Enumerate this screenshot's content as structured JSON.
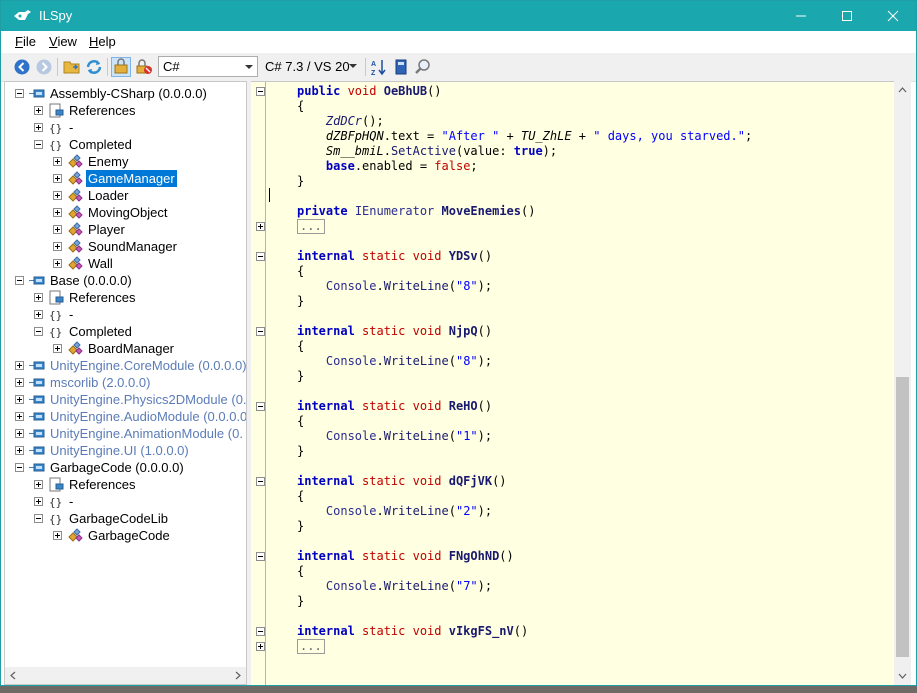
{
  "window": {
    "title": "ILSpy"
  },
  "menu": [
    {
      "accel": "F",
      "rest": "ile"
    },
    {
      "accel": "V",
      "rest": "iew"
    },
    {
      "accel": "H",
      "rest": "elp"
    }
  ],
  "toolbar": {
    "language": "C#",
    "version": "C# 7.3 / VS 20"
  },
  "tree": [
    {
      "label": "Assembly-CSharp (0.0.0.0)",
      "expander": "minus",
      "icon": "assembly-icon",
      "muted": false,
      "selected": false
    },
    {
      "label": "References",
      "expander": "plus",
      "icon": "references-icon",
      "muted": false,
      "selected": false
    },
    {
      "label": "-",
      "expander": "plus",
      "icon": "namespace-icon",
      "muted": false,
      "selected": false
    },
    {
      "label": "Completed",
      "expander": "minus",
      "icon": "namespace-icon",
      "muted": false,
      "selected": false
    },
    {
      "label": "Enemy",
      "expander": "plus",
      "icon": "class-icon",
      "muted": false,
      "selected": false
    },
    {
      "label": "GameManager",
      "expander": "plus",
      "icon": "class-icon",
      "muted": false,
      "selected": true
    },
    {
      "label": "Loader",
      "expander": "plus",
      "icon": "class-icon",
      "muted": false,
      "selected": false
    },
    {
      "label": "MovingObject",
      "expander": "plus",
      "icon": "class-icon",
      "muted": false,
      "selected": false
    },
    {
      "label": "Player",
      "expander": "plus",
      "icon": "class-icon",
      "muted": false,
      "selected": false
    },
    {
      "label": "SoundManager",
      "expander": "plus",
      "icon": "class-icon",
      "muted": false,
      "selected": false
    },
    {
      "label": "Wall",
      "expander": "plus",
      "icon": "class-icon",
      "muted": false,
      "selected": false
    },
    {
      "label": "Base (0.0.0.0)",
      "expander": "minus",
      "icon": "assembly-icon",
      "muted": false,
      "selected": false
    },
    {
      "label": "References",
      "expander": "plus",
      "icon": "references-icon",
      "muted": false,
      "selected": false
    },
    {
      "label": "-",
      "expander": "plus",
      "icon": "namespace-icon",
      "muted": false,
      "selected": false
    },
    {
      "label": "Completed",
      "expander": "minus",
      "icon": "namespace-icon",
      "muted": false,
      "selected": false
    },
    {
      "label": "BoardManager",
      "expander": "plus",
      "icon": "class-icon",
      "muted": false,
      "selected": false
    },
    {
      "label": "UnityEngine.CoreModule (0.0.0.0)",
      "expander": "plus",
      "icon": "assembly-icon",
      "muted": true,
      "selected": false
    },
    {
      "label": "mscorlib (2.0.0.0)",
      "expander": "plus",
      "icon": "assembly-icon",
      "muted": true,
      "selected": false
    },
    {
      "label": "UnityEngine.Physics2DModule (0.0",
      "expander": "plus",
      "icon": "assembly-icon",
      "muted": true,
      "selected": false
    },
    {
      "label": "UnityEngine.AudioModule (0.0.0.0",
      "expander": "plus",
      "icon": "assembly-icon",
      "muted": true,
      "selected": false
    },
    {
      "label": "UnityEngine.AnimationModule (0.",
      "expander": "plus",
      "icon": "assembly-icon",
      "muted": true,
      "selected": false
    },
    {
      "label": "UnityEngine.UI (1.0.0.0)",
      "expander": "plus",
      "icon": "assembly-icon",
      "muted": true,
      "selected": false
    },
    {
      "label": "GarbageCode (0.0.0.0)",
      "expander": "minus",
      "icon": "assembly-icon",
      "muted": false,
      "selected": false
    },
    {
      "label": "References",
      "expander": "plus",
      "icon": "references-icon",
      "muted": false,
      "selected": false
    },
    {
      "label": "-",
      "expander": "plus",
      "icon": "namespace-icon",
      "muted": false,
      "selected": false
    },
    {
      "label": "GarbageCodeLib",
      "expander": "minus",
      "icon": "namespace-icon",
      "muted": false,
      "selected": false
    },
    {
      "label": "GarbageCode",
      "expander": "plus",
      "icon": "class-icon",
      "muted": false,
      "selected": false
    }
  ],
  "code": [
    {
      "fold": "minus",
      "tokens": [
        [
          "kw",
          "public"
        ],
        [
          "",
          ""
        ],
        [
          "kw2",
          " void "
        ],
        [
          "fn",
          "OeBhUB"
        ],
        [
          "",
          "()"
        ]
      ]
    },
    {
      "fold": "",
      "tokens": [
        [
          "",
          "{"
        ]
      ]
    },
    {
      "fold": "",
      "tokens": [
        [
          "",
          "    "
        ],
        [
          "it meth",
          "ZdDCr"
        ],
        [
          "",
          "();"
        ]
      ]
    },
    {
      "fold": "",
      "tokens": [
        [
          "",
          "    "
        ],
        [
          "it",
          "dZBFpHQN"
        ],
        [
          "",
          ".text = "
        ],
        [
          "str",
          "\"After \""
        ],
        [
          "",
          " + "
        ],
        [
          "it",
          "TU_ZhLE"
        ],
        [
          "",
          " + "
        ],
        [
          "str",
          "\" days, you starved.\""
        ],
        [
          "",
          ";"
        ]
      ]
    },
    {
      "fold": "",
      "tokens": [
        [
          "",
          "    "
        ],
        [
          "it",
          "Sm__bmiL"
        ],
        [
          "",
          "."
        ],
        [
          "meth",
          "SetActive"
        ],
        [
          "",
          "(value: "
        ],
        [
          "kw",
          "true"
        ],
        [
          "",
          ");"
        ]
      ]
    },
    {
      "fold": "",
      "tokens": [
        [
          "",
          "    "
        ],
        [
          "kw",
          "base"
        ],
        [
          "",
          ".enabled = "
        ],
        [
          "kw2",
          "false"
        ],
        [
          "",
          ";"
        ]
      ]
    },
    {
      "fold": "",
      "tokens": [
        [
          "",
          "}"
        ]
      ]
    },
    {
      "fold": "",
      "tokens": [
        [
          "",
          ""
        ]
      ]
    },
    {
      "fold": "",
      "tokens": [
        [
          "kw",
          "private"
        ],
        [
          "",
          " "
        ],
        [
          "cls",
          "IEnumerator"
        ],
        [
          "",
          " "
        ],
        [
          "fn",
          "MoveEnemies"
        ],
        [
          "",
          "()"
        ]
      ]
    },
    {
      "fold": "plus",
      "tokens": [
        [
          "collapsed",
          "..."
        ]
      ]
    },
    {
      "fold": "",
      "tokens": [
        [
          "",
          ""
        ]
      ]
    },
    {
      "fold": "minus",
      "tokens": [
        [
          "kw",
          "internal"
        ],
        [
          "kw2",
          " static void "
        ],
        [
          "fn",
          "YDSv"
        ],
        [
          "",
          "()"
        ]
      ]
    },
    {
      "fold": "",
      "tokens": [
        [
          "",
          "{"
        ]
      ]
    },
    {
      "fold": "",
      "tokens": [
        [
          "",
          "    "
        ],
        [
          "cls",
          "Console"
        ],
        [
          "",
          "."
        ],
        [
          "meth",
          "WriteLine"
        ],
        [
          "",
          "("
        ],
        [
          "str",
          "\"8\""
        ],
        [
          "",
          ");"
        ]
      ]
    },
    {
      "fold": "",
      "tokens": [
        [
          "",
          "}"
        ]
      ]
    },
    {
      "fold": "",
      "tokens": [
        [
          "",
          ""
        ]
      ]
    },
    {
      "fold": "minus",
      "tokens": [
        [
          "kw",
          "internal"
        ],
        [
          "kw2",
          " static void "
        ],
        [
          "fn",
          "NjpQ"
        ],
        [
          "",
          "()"
        ]
      ]
    },
    {
      "fold": "",
      "tokens": [
        [
          "",
          "{"
        ]
      ]
    },
    {
      "fold": "",
      "tokens": [
        [
          "",
          "    "
        ],
        [
          "cls",
          "Console"
        ],
        [
          "",
          "."
        ],
        [
          "meth",
          "WriteLine"
        ],
        [
          "",
          "("
        ],
        [
          "str",
          "\"8\""
        ],
        [
          "",
          ");"
        ]
      ]
    },
    {
      "fold": "",
      "tokens": [
        [
          "",
          "}"
        ]
      ]
    },
    {
      "fold": "",
      "tokens": [
        [
          "",
          ""
        ]
      ]
    },
    {
      "fold": "minus",
      "tokens": [
        [
          "kw",
          "internal"
        ],
        [
          "kw2",
          " static void "
        ],
        [
          "fn",
          "ReHO"
        ],
        [
          "",
          "()"
        ]
      ]
    },
    {
      "fold": "",
      "tokens": [
        [
          "",
          "{"
        ]
      ]
    },
    {
      "fold": "",
      "tokens": [
        [
          "",
          "    "
        ],
        [
          "cls",
          "Console"
        ],
        [
          "",
          "."
        ],
        [
          "meth",
          "WriteLine"
        ],
        [
          "",
          "("
        ],
        [
          "str",
          "\"1\""
        ],
        [
          "",
          ");"
        ]
      ]
    },
    {
      "fold": "",
      "tokens": [
        [
          "",
          "}"
        ]
      ]
    },
    {
      "fold": "",
      "tokens": [
        [
          "",
          ""
        ]
      ]
    },
    {
      "fold": "minus",
      "tokens": [
        [
          "kw",
          "internal"
        ],
        [
          "kw2",
          " static void "
        ],
        [
          "fn",
          "dQFjVK"
        ],
        [
          "",
          "()"
        ]
      ]
    },
    {
      "fold": "",
      "tokens": [
        [
          "",
          "{"
        ]
      ]
    },
    {
      "fold": "",
      "tokens": [
        [
          "",
          "    "
        ],
        [
          "cls",
          "Console"
        ],
        [
          "",
          "."
        ],
        [
          "meth",
          "WriteLine"
        ],
        [
          "",
          "("
        ],
        [
          "str",
          "\"2\""
        ],
        [
          "",
          ");"
        ]
      ]
    },
    {
      "fold": "",
      "tokens": [
        [
          "",
          "}"
        ]
      ]
    },
    {
      "fold": "",
      "tokens": [
        [
          "",
          ""
        ]
      ]
    },
    {
      "fold": "minus",
      "tokens": [
        [
          "kw",
          "internal"
        ],
        [
          "kw2",
          " static void "
        ],
        [
          "fn",
          "FNgOhND"
        ],
        [
          "",
          "()"
        ]
      ]
    },
    {
      "fold": "",
      "tokens": [
        [
          "",
          "{"
        ]
      ]
    },
    {
      "fold": "",
      "tokens": [
        [
          "",
          "    "
        ],
        [
          "cls",
          "Console"
        ],
        [
          "",
          "."
        ],
        [
          "meth",
          "WriteLine"
        ],
        [
          "",
          "("
        ],
        [
          "str",
          "\"7\""
        ],
        [
          "",
          ");"
        ]
      ]
    },
    {
      "fold": "",
      "tokens": [
        [
          "",
          "}"
        ]
      ]
    },
    {
      "fold": "",
      "tokens": [
        [
          "",
          ""
        ]
      ]
    },
    {
      "fold": "minus",
      "tokens": [
        [
          "kw",
          "internal"
        ],
        [
          "kw2",
          " static void "
        ],
        [
          "fn",
          "vIkgFS_nV"
        ],
        [
          "",
          "()"
        ]
      ]
    },
    {
      "fold": "plus",
      "tokens": [
        [
          "collapsed",
          "..."
        ]
      ]
    }
  ]
}
